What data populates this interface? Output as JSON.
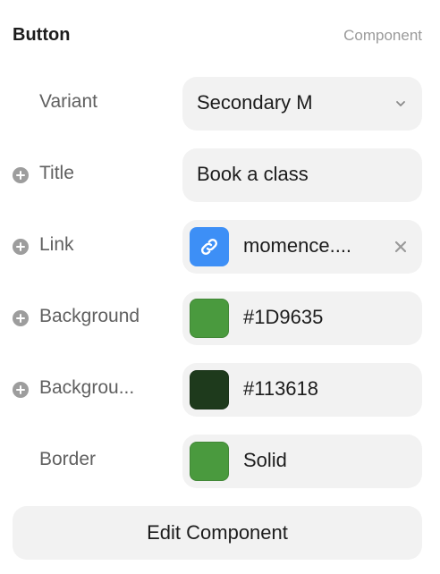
{
  "header": {
    "title": "Button",
    "subtitle": "Component"
  },
  "rows": [
    {
      "label": "Variant",
      "value": "Secondary M",
      "has_plus": false,
      "control": "dropdown"
    },
    {
      "label": "Title",
      "value": "Book a class",
      "has_plus": true,
      "control": "text"
    },
    {
      "label": "Link",
      "value": "momence....",
      "has_plus": true,
      "control": "link",
      "icon": "link-icon",
      "icon_color": "#3D8FF6"
    },
    {
      "label": "Background",
      "value": "#1D9635",
      "has_plus": true,
      "control": "color",
      "swatch": "#4A9A3E"
    },
    {
      "label": "Backgrou...",
      "value": "#113618",
      "has_plus": true,
      "control": "color",
      "swatch": "#1E3A1C"
    },
    {
      "label": "Border",
      "value": "Solid",
      "has_plus": false,
      "control": "color",
      "swatch": "#4A9A3E"
    }
  ],
  "edit_button": {
    "label": "Edit Component"
  },
  "icons": {
    "add": "plus-circle-icon",
    "dropdown": "chevron-down-icon",
    "link": "link-icon",
    "clear": "close-icon"
  },
  "colors": {
    "field_bg": "#F2F2F2",
    "label": "#606060",
    "muted": "#9A9A9A"
  }
}
